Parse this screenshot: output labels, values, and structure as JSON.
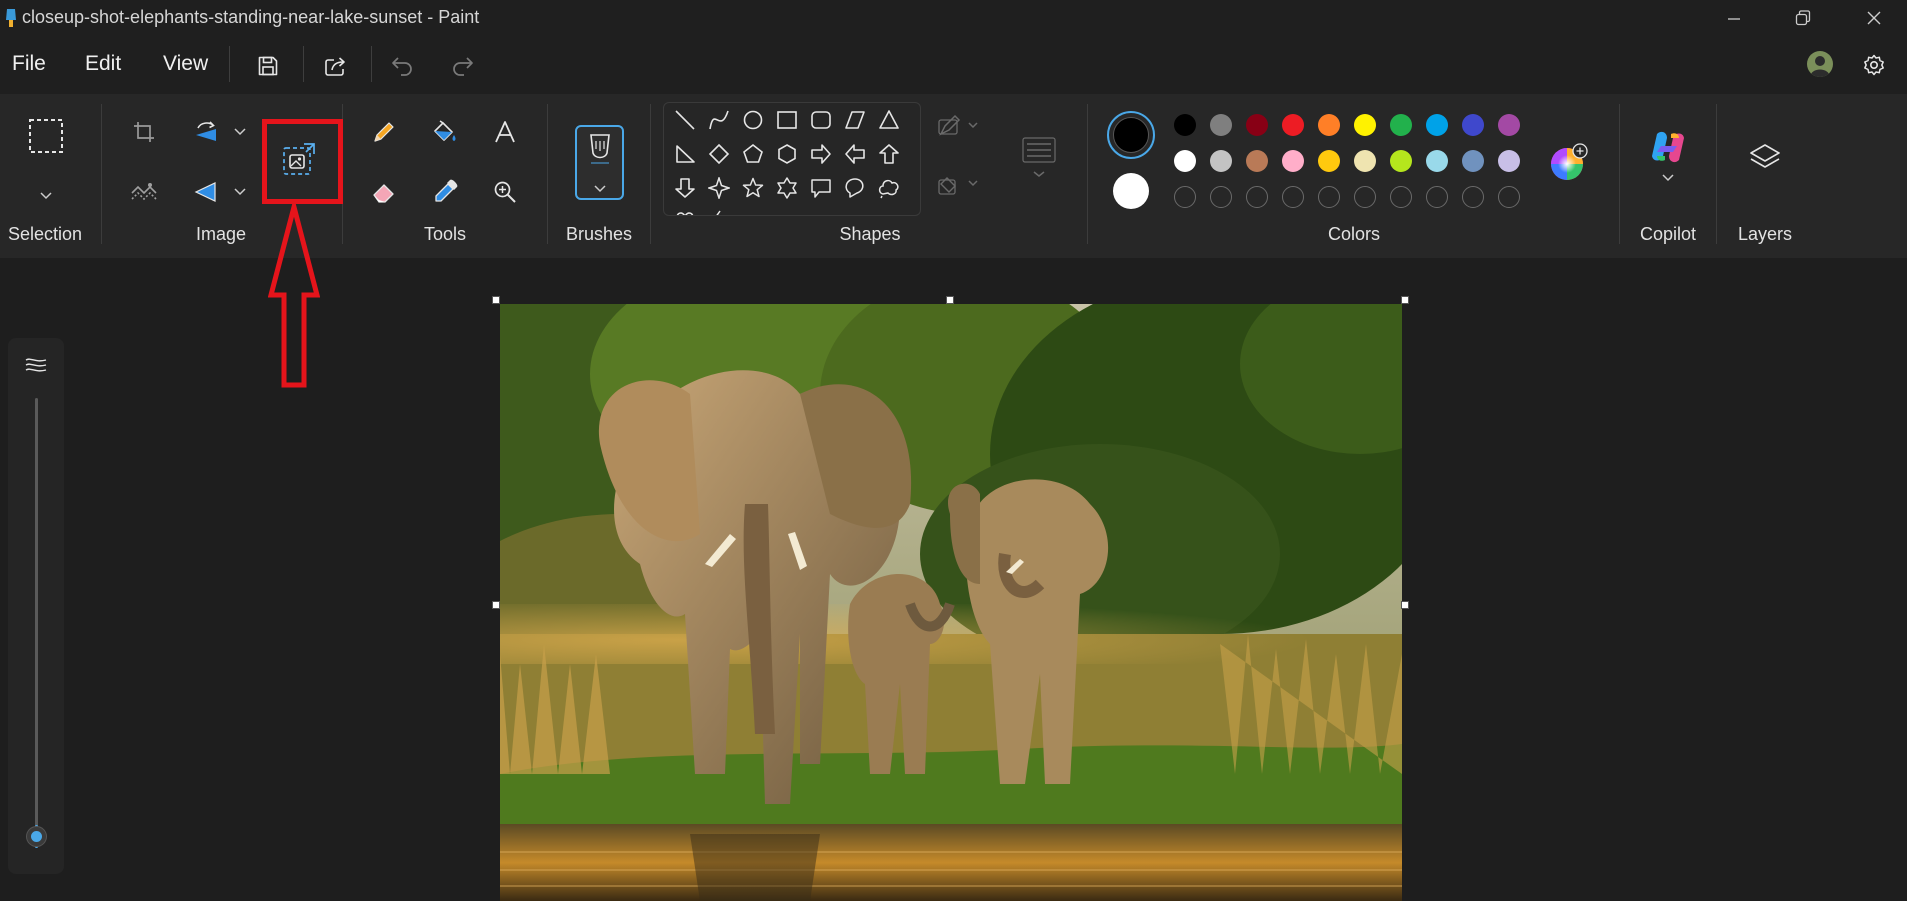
{
  "window": {
    "title": "closeup-shot-elephants-standing-near-lake-sunset - Paint",
    "controls": [
      "minimize-icon",
      "restore-icon",
      "close-icon"
    ]
  },
  "menu": {
    "file": "File",
    "edit": "Edit",
    "view": "View",
    "icons": [
      "save-icon",
      "share-icon",
      "undo-icon",
      "redo-icon",
      "account-avatar",
      "gear-icon"
    ]
  },
  "ribbon": {
    "groups": {
      "selection": "Selection",
      "image": "Image",
      "tools": "Tools",
      "brushes": "Brushes",
      "shapes": "Shapes",
      "colors": "Colors",
      "copilot": "Copilot",
      "layers": "Layers"
    },
    "image_tools": [
      "crop-icon",
      "rotate-icon",
      "remove-background-icon",
      "flip-icon",
      "image-resize-icon"
    ],
    "tools": [
      "pencil-icon",
      "fill-icon",
      "text-icon",
      "eraser-icon",
      "color-picker-icon",
      "magnifier-icon"
    ],
    "shapes": [
      "line",
      "curve",
      "oval",
      "rectangle",
      "rounded-rectangle",
      "polygon",
      "triangle",
      "right-triangle",
      "diamond",
      "pentagon",
      "hexagon",
      "right-arrow",
      "left-arrow",
      "up-arrow",
      "down-arrow",
      "four-point-star",
      "five-point-star",
      "six-point-star",
      "callout-rectangle",
      "callout-oval",
      "callout-cloud"
    ]
  },
  "colors": {
    "primary": "#000000",
    "secondary": "#ffffff",
    "row1": [
      "#000000",
      "#7f7f7f",
      "#880015",
      "#ed1c24",
      "#ff7f27",
      "#fff200",
      "#22b14c",
      "#00a2e8",
      "#3f48cc",
      "#a349a4"
    ],
    "row2": [
      "#ffffff",
      "#c3c3c3",
      "#b97a57",
      "#ffaec9",
      "#ffc90e",
      "#efe4b0",
      "#b5e61d",
      "#99d9ea",
      "#7092be",
      "#c8bfe7"
    ],
    "custom_empty_slots": 10
  },
  "annotation": {
    "color": "#e5141b",
    "target": "image-resize-icon"
  }
}
